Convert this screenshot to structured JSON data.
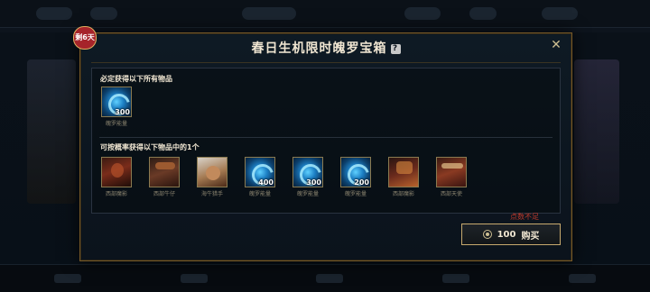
{
  "modal": {
    "badge": "剩6天",
    "title": "春日生机限时魄罗宝箱",
    "help_symbol": "?",
    "close_symbol": "✕",
    "guaranteed_label": "必定获得以下所有物品",
    "chance_label": "可按概率获得以下物品中的1个",
    "guaranteed_items": [
      {
        "name": "魄罗能量",
        "qty": "300",
        "type": "essence"
      }
    ],
    "chance_items": [
      {
        "name": "西部魔影",
        "qty": "",
        "type": "skin-red"
      },
      {
        "name": "西部牛仔",
        "qty": "",
        "type": "skin-cowboy"
      },
      {
        "name": "海牛猎手",
        "qty": "",
        "type": "skin-bull"
      },
      {
        "name": "魄罗能量",
        "qty": "400",
        "type": "essence"
      },
      {
        "name": "魄罗能量",
        "qty": "300",
        "type": "essence"
      },
      {
        "name": "魄罗能量",
        "qty": "200",
        "type": "essence"
      },
      {
        "name": "西部魔影",
        "qty": "",
        "type": "skin-red2"
      },
      {
        "name": "西部天使",
        "qty": "",
        "type": "skin-angel"
      }
    ],
    "insufficient_text": "点数不足",
    "buy": {
      "price": "100",
      "label": "购买"
    }
  },
  "icons": {
    "help": "help-icon",
    "close": "close-icon",
    "currency": "coin-icon"
  },
  "colors": {
    "gold_border": "#785a28",
    "accent_text": "#f0e6d2",
    "warning": "#c0392b",
    "essence_blue": "#1c7fc4"
  }
}
